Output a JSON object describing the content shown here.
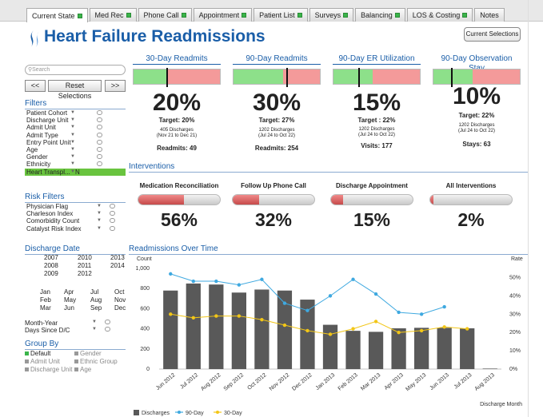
{
  "tabs": [
    {
      "label": "Current State",
      "active": true,
      "dot": true
    },
    {
      "label": "Med Rec",
      "dot": true
    },
    {
      "label": "Phone Call",
      "dot": true
    },
    {
      "label": "Appointment",
      "dot": true
    },
    {
      "label": "Patient List",
      "dot": true
    },
    {
      "label": "Surveys",
      "dot": true
    },
    {
      "label": "Balancing",
      "dot": true
    },
    {
      "label": "LOS & Costing",
      "dot": true
    },
    {
      "label": "Notes",
      "dot": false
    }
  ],
  "title": "Heart Failure Readmissions",
  "current_selections": "Current Selections",
  "search": {
    "placeholder": "Search"
  },
  "nav": {
    "prev": "<<",
    "reset": "Reset Selections",
    "next": ">>"
  },
  "filters": {
    "heading": "Filters",
    "items": [
      {
        "label": "Patient Cohort"
      },
      {
        "label": "Discharge Unit"
      },
      {
        "label": "Admit Unit"
      },
      {
        "label": "Admit Type"
      },
      {
        "label": "Entry Point Unit"
      },
      {
        "label": "Age"
      },
      {
        "label": "Gender"
      },
      {
        "label": "Ethnicity"
      },
      {
        "label": "Heart Transpl...",
        "value": "N",
        "selected": true
      }
    ]
  },
  "risk_filters": {
    "heading": "Risk Filters",
    "items": [
      {
        "label": "Physician Flag"
      },
      {
        "label": "Charleson Index"
      },
      {
        "label": "Comorbidity Count"
      },
      {
        "label": "Catalyst Risk Index"
      }
    ]
  },
  "discharge_date": {
    "heading": "Discharge Date",
    "years": [
      "2007",
      "2010",
      "2013",
      "2008",
      "2011",
      "2014",
      "2009",
      "2012"
    ],
    "months": [
      "Jan",
      "Apr",
      "Jul",
      "Oct",
      "Feb",
      "May",
      "Aug",
      "Nov",
      "Mar",
      "Jun",
      "Sep",
      "Dec"
    ],
    "month_year": "Month-Year",
    "days_since": "Days Since D/C"
  },
  "group_by": {
    "heading": "Group By",
    "items": [
      {
        "label": "Default",
        "on": true
      },
      {
        "label": "Gender",
        "on": false
      },
      {
        "label": "Admit Unit",
        "on": false
      },
      {
        "label": "Ethnic Group",
        "on": false
      },
      {
        "label": "Discharge Unit",
        "on": false
      },
      {
        "label": "Age",
        "on": false
      }
    ]
  },
  "kpis": [
    {
      "heading": "30-Day Readmits",
      "pct": "20%",
      "target": "Target: 20%",
      "line1": "405 Discharges",
      "line2": "(Nov 21 to Dec 21)",
      "foot": "Readmits: 49"
    },
    {
      "heading": "90-Day Readmits",
      "pct": "30%",
      "target": "Target: 27%",
      "line1": "1202 Discharges",
      "line2": "(Jul 24 to Oct 22)",
      "foot": "Readmits: 254"
    },
    {
      "heading": "90-Day ER Utilization",
      "pct": "15%",
      "target": "Target : 22%",
      "line1": "1202 Discharges",
      "line2": "(Jul 24 to Oct 22)",
      "foot": "Visits:  177"
    },
    {
      "heading": "90-Day Observation Stay",
      "pct": "10%",
      "target": "Target: 22%",
      "line1": "1202 Discharges",
      "line2": "(Jul 24 to Oct 22)",
      "foot": "Stays: 63"
    }
  ],
  "interventions": {
    "heading": "Interventions",
    "items": [
      {
        "label": "Medication Reconciliation",
        "pct": "56%",
        "fill": 0.56
      },
      {
        "label": "Follow Up Phone Call",
        "pct": "32%",
        "fill": 0.32
      },
      {
        "label": "Discharge Appointment",
        "pct": "15%",
        "fill": 0.15
      },
      {
        "label": "All Interventions",
        "pct": "2%",
        "fill": 0.02
      }
    ]
  },
  "chart_heading": "Readmissions Over Time",
  "chart_data": {
    "type": "bar",
    "categories": [
      "Jun 2012",
      "Jul 2012",
      "Aug 2012",
      "Sep 2012",
      "Oct 2012",
      "Nov 2012",
      "Dec 2012",
      "Jan 2013",
      "Feb 2013",
      "Mar 2013",
      "Apr 2013",
      "May 2013",
      "Jun 2013",
      "Jul 2013",
      "Aug 2013"
    ],
    "series": [
      {
        "name": "Discharges",
        "type": "bar",
        "axis": "left",
        "color": "#595959",
        "values": [
          780,
          850,
          840,
          760,
          790,
          780,
          690,
          440,
          380,
          370,
          405,
          410,
          410,
          405,
          5
        ]
      },
      {
        "name": "90-Day",
        "type": "line",
        "axis": "right",
        "color": "#3fa9e0",
        "values": [
          52,
          48,
          48,
          46,
          49,
          36,
          32,
          40,
          49,
          41,
          31,
          30,
          34,
          null,
          null
        ]
      },
      {
        "name": "30-Day",
        "type": "line",
        "axis": "right",
        "color": "#f2c617",
        "values": [
          30,
          28,
          29,
          29,
          27,
          24,
          21,
          19,
          22,
          26,
          20,
          21,
          23,
          22,
          null
        ]
      }
    ],
    "ylabel": "Count",
    "ylabel_right": "Rate",
    "xlabel": "Discharge Month",
    "ylim": [
      0,
      1000
    ],
    "ylim_right": [
      0,
      55
    ],
    "yticks": [
      "0",
      "200",
      "400",
      "600",
      "800",
      "1,000"
    ],
    "yticks_right": [
      "0%",
      "10%",
      "20%",
      "30%",
      "40%",
      "50%"
    ]
  }
}
